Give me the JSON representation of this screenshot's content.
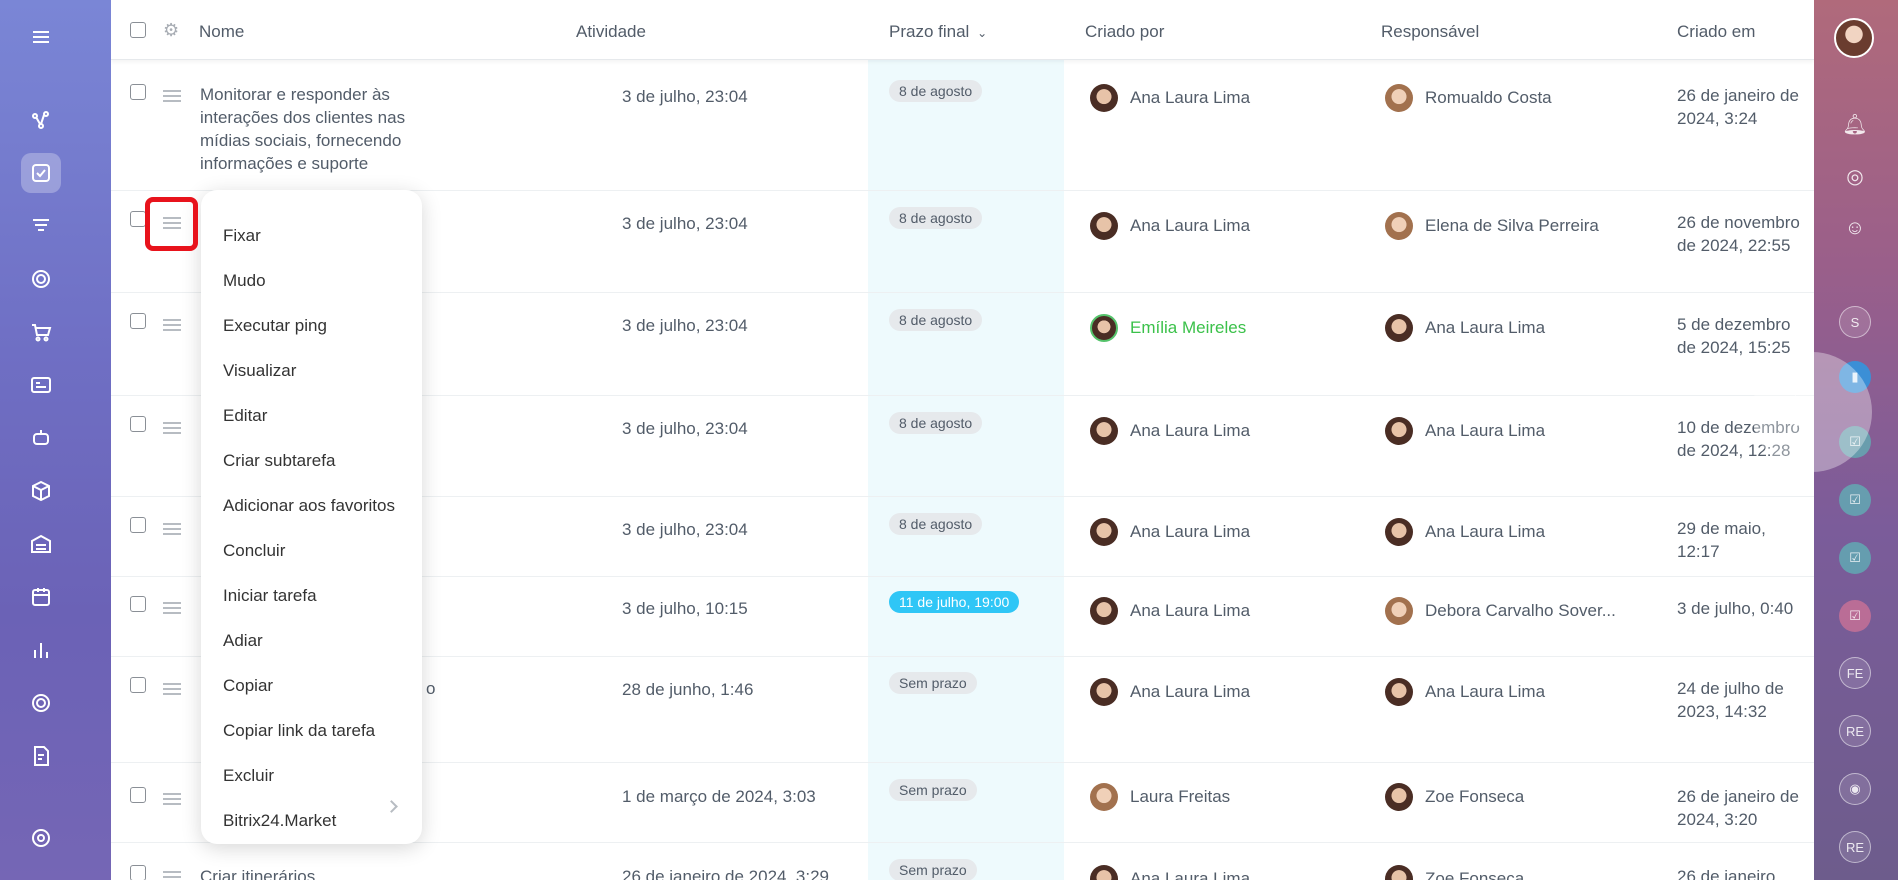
{
  "header": {
    "name": "Nome",
    "activity": "Atividade",
    "deadline": "Prazo final",
    "created_by": "Criado por",
    "responsible": "Responsável",
    "created_at": "Criado em"
  },
  "rows": [
    {
      "name": "Monitorar e responder às interações dos clientes nas mídias sociais, fornecendo informações e suporte",
      "activity": "3 de julho, 23:04",
      "deadline": "8 de agosto",
      "creator": "Ana Laura Lima",
      "responsible": "Romualdo Costa",
      "created": "26 de janeiro de 2024, 3:24"
    },
    {
      "name": "",
      "activity": "3 de julho, 23:04",
      "deadline": "8 de agosto",
      "creator": "Ana Laura Lima",
      "responsible": "Elena de Silva Perreira",
      "created": "26 de novembro de 2024, 22:55"
    },
    {
      "name": "",
      "activity": "3 de julho, 23:04",
      "deadline": "8 de agosto",
      "creator": "Emília Meireles",
      "responsible": "Ana Laura Lima",
      "created": "5 de dezembro de 2024, 15:25"
    },
    {
      "name": "",
      "activity": "3 de julho, 23:04",
      "deadline": "8 de agosto",
      "creator": "Ana Laura Lima",
      "responsible": "Ana Laura Lima",
      "created": "10 de dezembro de 2024, 12:28"
    },
    {
      "name": "",
      "activity": "3 de julho, 23:04",
      "deadline": "8 de agosto",
      "creator": "Ana Laura Lima",
      "responsible": "Ana Laura Lima",
      "created": "29 de maio, 12:17"
    },
    {
      "name": "",
      "activity": "3 de julho, 10:15",
      "deadline": "11 de julho, 19:00",
      "creator": "Ana Laura Lima",
      "responsible": "Debora Carvalho Sover...",
      "created": "3 de julho, 0:40"
    },
    {
      "name": "o",
      "activity": "28 de junho, 1:46",
      "deadline": "Sem prazo",
      "creator": "Ana Laura Lima",
      "responsible": "Ana Laura Lima",
      "created": "24 de julho de 2023, 14:32"
    },
    {
      "name": "",
      "activity": "1 de março de 2024, 3:03",
      "deadline": "Sem prazo",
      "creator": "Laura Freitas",
      "responsible": "Zoe Fonseca",
      "created": "26 de janeiro de 2024, 3:20"
    },
    {
      "name": "Criar itinerários",
      "activity": "26 de janeiro de 2024, 3:29",
      "deadline": "Sem prazo",
      "creator": "Ana Laura Lima",
      "responsible": "Zoe Fonseca",
      "created": "26 de janeiro"
    }
  ],
  "menu": {
    "items": [
      "Fixar",
      "Mudo",
      "Executar ping",
      "Visualizar",
      "Editar",
      "Criar subtarefa",
      "Adicionar aos favoritos",
      "Concluir",
      "Iniciar tarefa",
      "Adiar",
      "Copiar",
      "Copiar link da tarefa",
      "Excluir",
      "Bitrix24.Market"
    ]
  },
  "rightbar": {
    "badges": [
      "S",
      "FE",
      "RE",
      "RE"
    ]
  },
  "colors": {
    "accent": "#2fc6f6",
    "highlight": "#e8131c",
    "creator_online": "#3bc14a"
  }
}
